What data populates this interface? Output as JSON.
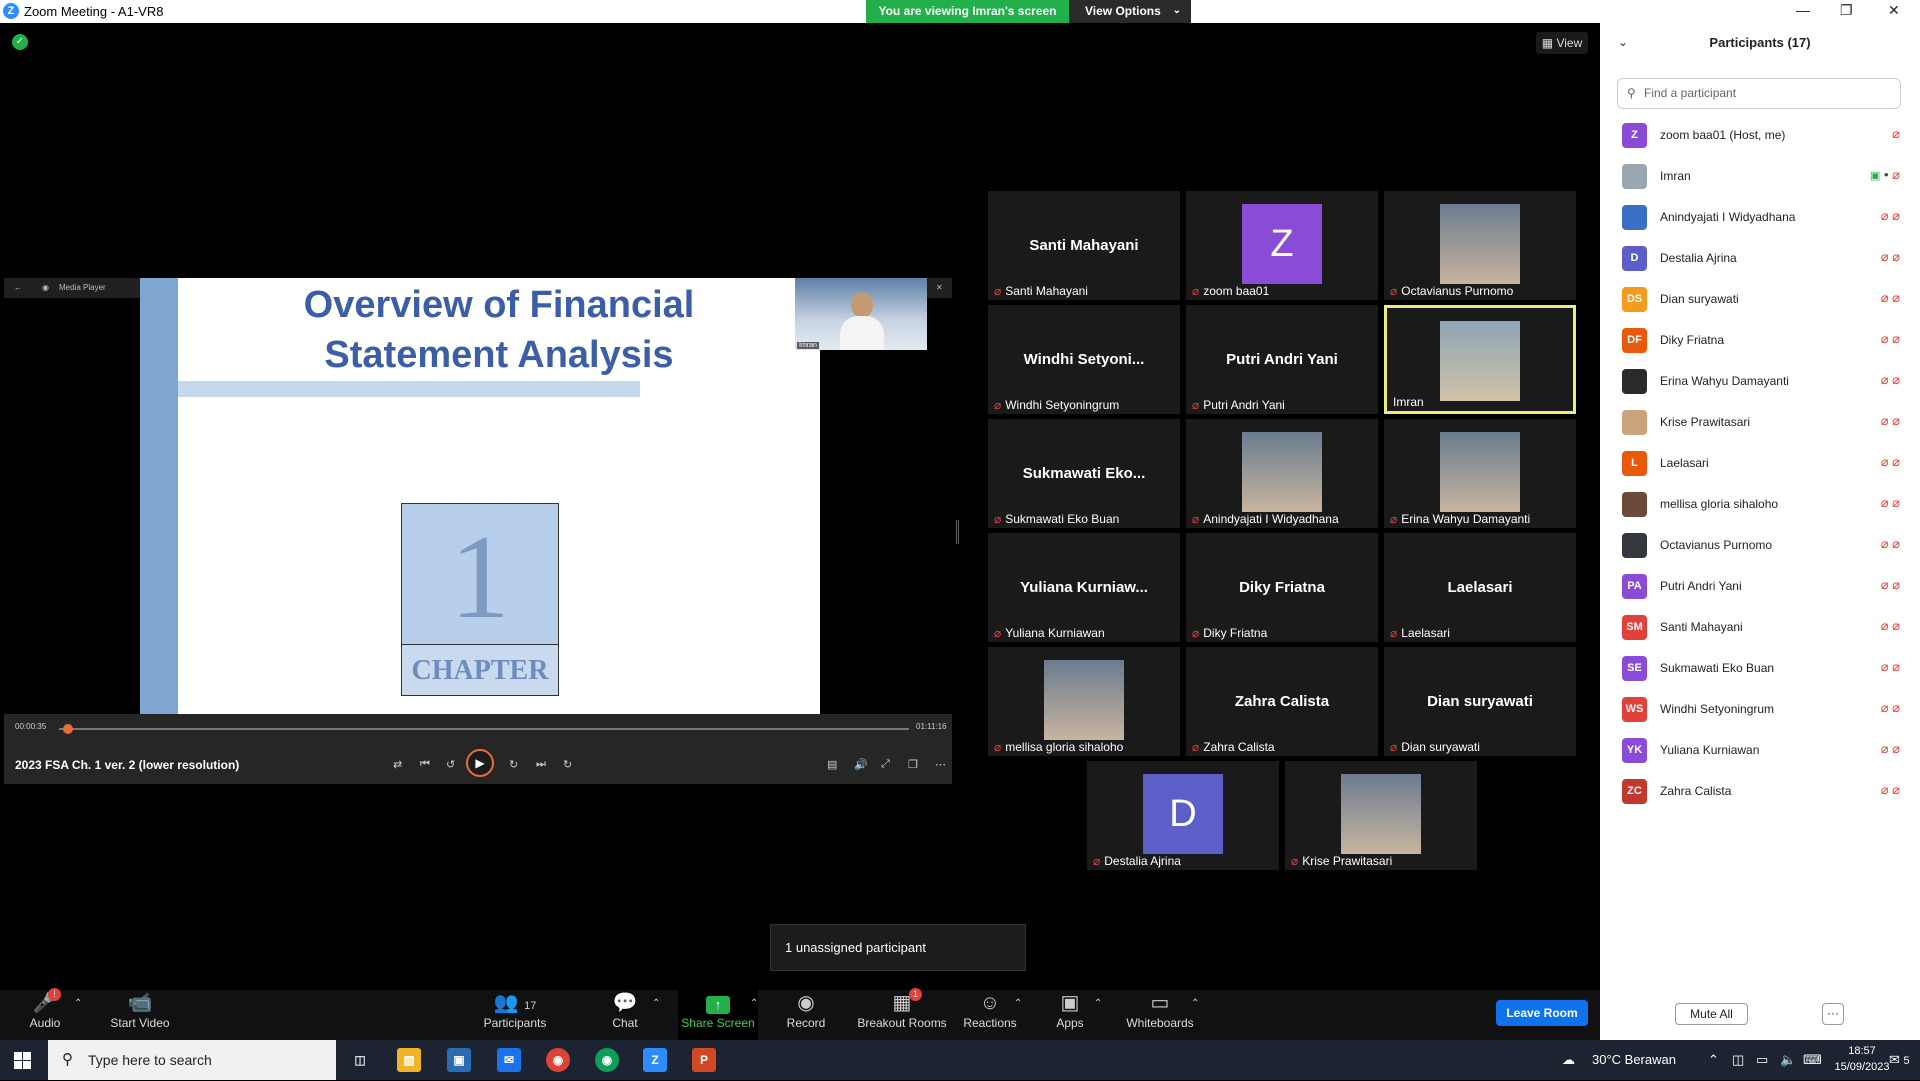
{
  "window": {
    "title": "Zoom Meeting - A1-VR8",
    "logo": "Z"
  },
  "banner": {
    "viewing": "You are viewing Imran's screen",
    "view_options": "View Options"
  },
  "view_button": "View",
  "media_player": {
    "app_name": "Media Player",
    "slide_title_1": "Overview of Financial",
    "slide_title_2": "Statement Analysis",
    "chapter_number": "1",
    "chapter_label": "CHAPTER",
    "camera_label": "Imran",
    "time_elapsed": "00:00:35",
    "time_total": "01:11:16",
    "progress": 0.01,
    "video_title": "2023 FSA Ch. 1 ver. 2 (lower resolution)"
  },
  "tiles": [
    {
      "display": "Santi Mahayani",
      "label": "Santi Mahayani",
      "muted": true
    },
    {
      "display": "Z",
      "label": "zoom baa01",
      "muted": true,
      "avatar_color": "#8a4cd6"
    },
    {
      "display": "",
      "label": "Octavianus Purnomo",
      "muted": true,
      "photo": true
    },
    {
      "display": "Windhi  Setyoni...",
      "label": "Windhi Setyoningrum",
      "muted": true
    },
    {
      "display": "Putri Andri Yani",
      "label": "Putri Andri Yani",
      "muted": true
    },
    {
      "display": "",
      "label": "Imran",
      "muted": false,
      "photo": true,
      "active": true
    },
    {
      "display": "Sukmawati   Eko...",
      "label": "Sukmawati  Eko Buan",
      "muted": true
    },
    {
      "display": "",
      "label": "Anindyajati I Widyadhana",
      "muted": true,
      "photo": true
    },
    {
      "display": "",
      "label": "Erina Wahyu Damayanti",
      "muted": true,
      "photo": true
    },
    {
      "display": "Yuliana  Kurniaw...",
      "label": "Yuliana Kurniawan",
      "muted": true
    },
    {
      "display": "Diky Friatna",
      "label": "Diky Friatna",
      "muted": true
    },
    {
      "display": "Laelasari",
      "label": "Laelasari",
      "muted": true
    },
    {
      "display": "",
      "label": "mellisa gloria sihaloho",
      "muted": true,
      "photo": true
    },
    {
      "display": "Zahra Calista",
      "label": "Zahra Calista",
      "muted": true
    },
    {
      "display": "Dian suryawati",
      "label": "Dian suryawati",
      "muted": true
    },
    {
      "display": "D",
      "label": "Destalia Ajrina",
      "muted": true,
      "avatar_color": "#5b5fc7"
    },
    {
      "display": "",
      "label": "Krise Prawitasari",
      "muted": true,
      "photo": true
    }
  ],
  "tooltip": "1 unassigned participant",
  "toolbar": {
    "audio": "Audio",
    "start_video": "Start Video",
    "participants": "Participants",
    "participants_count": "17",
    "chat": "Chat",
    "share_screen": "Share Screen",
    "record": "Record",
    "breakout_rooms": "Breakout Rooms",
    "breakout_badge": "1",
    "audio_badge": "!",
    "reactions": "Reactions",
    "apps": "Apps",
    "whiteboards": "Whiteboards",
    "leave_room": "Leave Room"
  },
  "panel": {
    "title": "Participants (17)",
    "search_placeholder": "Find a participant",
    "mute_all": "Mute All",
    "more": "···",
    "participants": [
      {
        "initials": "Z",
        "name": "zoom baa01 (Host, me)",
        "color": "#8a4cd6"
      },
      {
        "initials": "",
        "name": "Imran",
        "color": "#9aa7b3"
      },
      {
        "initials": "",
        "name": "Anindyajati I Widyadhana",
        "color": "#3b6fc6"
      },
      {
        "initials": "D",
        "name": "Destalia Ajrina",
        "color": "#5b5fc7"
      },
      {
        "initials": "DS",
        "name": "Dian suryawati",
        "color": "#f29b1d"
      },
      {
        "initials": "DF",
        "name": "Diky Friatna",
        "color": "#e8590c"
      },
      {
        "initials": "",
        "name": "Erina Wahyu Damayanti",
        "color": "#2a2a2a"
      },
      {
        "initials": "",
        "name": "Krise Prawitasari",
        "color": "#c9a47a"
      },
      {
        "initials": "L",
        "name": "Laelasari",
        "color": "#e8590c"
      },
      {
        "initials": "",
        "name": "mellisa gloria sihaloho",
        "color": "#6b4a3a"
      },
      {
        "initials": "",
        "name": "Octavianus Purnomo",
        "color": "#34383c"
      },
      {
        "initials": "PA",
        "name": "Putri Andri Yani",
        "color": "#8a4cd6"
      },
      {
        "initials": "SM",
        "name": "Santi Mahayani",
        "color": "#e0413b"
      },
      {
        "initials": "SE",
        "name": "Sukmawati  Eko Buan",
        "color": "#8a4cd6"
      },
      {
        "initials": "WS",
        "name": "Windhi Setyoningrum",
        "color": "#e0413b"
      },
      {
        "initials": "YK",
        "name": "Yuliana Kurniawan",
        "color": "#8a4cd6"
      },
      {
        "initials": "ZC",
        "name": "Zahra Calista",
        "color": "#c0392b"
      }
    ]
  },
  "taskbar": {
    "search_placeholder": "Type here to search",
    "weather": "30°C  Berawan",
    "time": "18:57",
    "date": "15/09/2023",
    "notifications": "5"
  }
}
